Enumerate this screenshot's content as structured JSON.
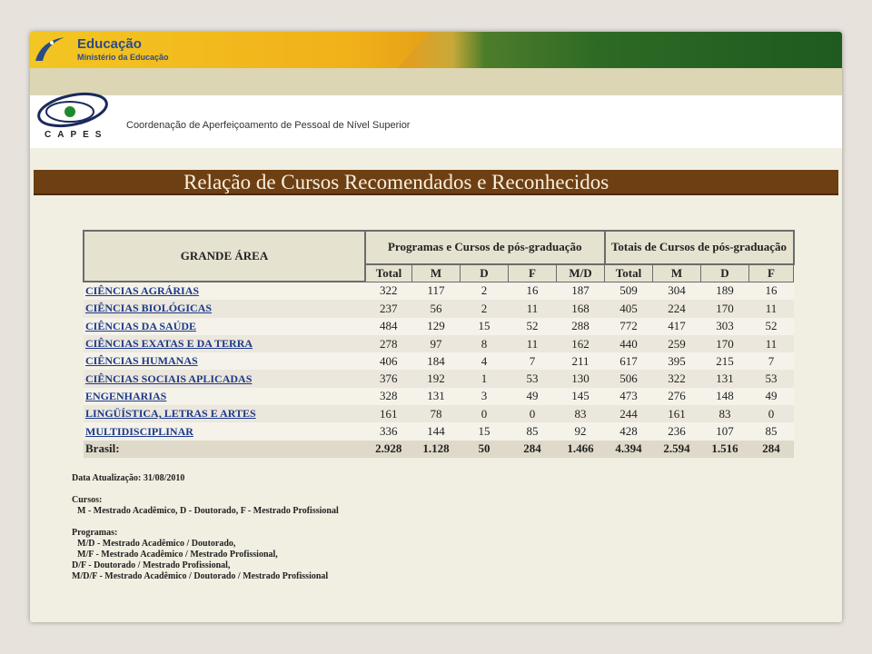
{
  "gov": {
    "title": "Educação",
    "subtitle": "Ministério da Educação"
  },
  "capes": {
    "acronym": "CAPES",
    "name": "Coordenação de Aperfeiçoamento de Pessoal de Nível Superior"
  },
  "page_title": "Relação de Cursos Recomendados e Reconhecidos",
  "table": {
    "area_header": "GRANDE ÁREA",
    "group1_header": "Programas e Cursos de pós-graduação",
    "group2_header": "Totais de Cursos de pós-graduação",
    "sub_headers": [
      "Total",
      "M",
      "D",
      "F",
      "M/D",
      "Total",
      "M",
      "D",
      "F"
    ],
    "rows": [
      {
        "area": "CIÊNCIAS AGRÁRIAS",
        "values": [
          "322",
          "117",
          "2",
          "16",
          "187",
          "509",
          "304",
          "189",
          "16"
        ]
      },
      {
        "area": "CIÊNCIAS BIOLÓGICAS",
        "values": [
          "237",
          "56",
          "2",
          "11",
          "168",
          "405",
          "224",
          "170",
          "11"
        ]
      },
      {
        "area": "CIÊNCIAS DA SAÚDE",
        "values": [
          "484",
          "129",
          "15",
          "52",
          "288",
          "772",
          "417",
          "303",
          "52"
        ]
      },
      {
        "area": "CIÊNCIAS EXATAS E DA TERRA",
        "values": [
          "278",
          "97",
          "8",
          "11",
          "162",
          "440",
          "259",
          "170",
          "11"
        ]
      },
      {
        "area": "CIÊNCIAS HUMANAS",
        "values": [
          "406",
          "184",
          "4",
          "7",
          "211",
          "617",
          "395",
          "215",
          "7"
        ]
      },
      {
        "area": "CIÊNCIAS SOCIAIS APLICADAS",
        "values": [
          "376",
          "192",
          "1",
          "53",
          "130",
          "506",
          "322",
          "131",
          "53"
        ]
      },
      {
        "area": "ENGENHARIAS",
        "values": [
          "328",
          "131",
          "3",
          "49",
          "145",
          "473",
          "276",
          "148",
          "49"
        ]
      },
      {
        "area": "LINGÜÍSTICA, LETRAS E ARTES",
        "values": [
          "161",
          "78",
          "0",
          "0",
          "83",
          "244",
          "161",
          "83",
          "0"
        ]
      },
      {
        "area": "MULTIDISCIPLINAR",
        "values": [
          "336",
          "144",
          "15",
          "85",
          "92",
          "428",
          "236",
          "107",
          "85"
        ]
      }
    ],
    "total": {
      "area": "Brasil:",
      "values": [
        "2.928",
        "1.128",
        "50",
        "284",
        "1.466",
        "4.394",
        "2.594",
        "1.516",
        "284"
      ]
    }
  },
  "notes": {
    "update": "Data Atualização: 31/08/2010",
    "cursos_title": "Cursos:",
    "cursos_text": "M - Mestrado Acadêmico, D - Doutorado, F - Mestrado Profissional",
    "programas_title": "Programas:",
    "programas_lines": [
      "M/D - Mestrado Acadêmico / Doutorado,",
      "M/F - Mestrado Acadêmico / Mestrado Profissional,",
      "D/F - Doutorado / Mestrado Profissional,",
      "M/D/F - Mestrado Acadêmico / Doutorado / Mestrado Profissional"
    ]
  },
  "colors": {
    "title_bar": "#6e3f12",
    "link": "#1c3a8a",
    "gov_text": "#2d4b86"
  }
}
